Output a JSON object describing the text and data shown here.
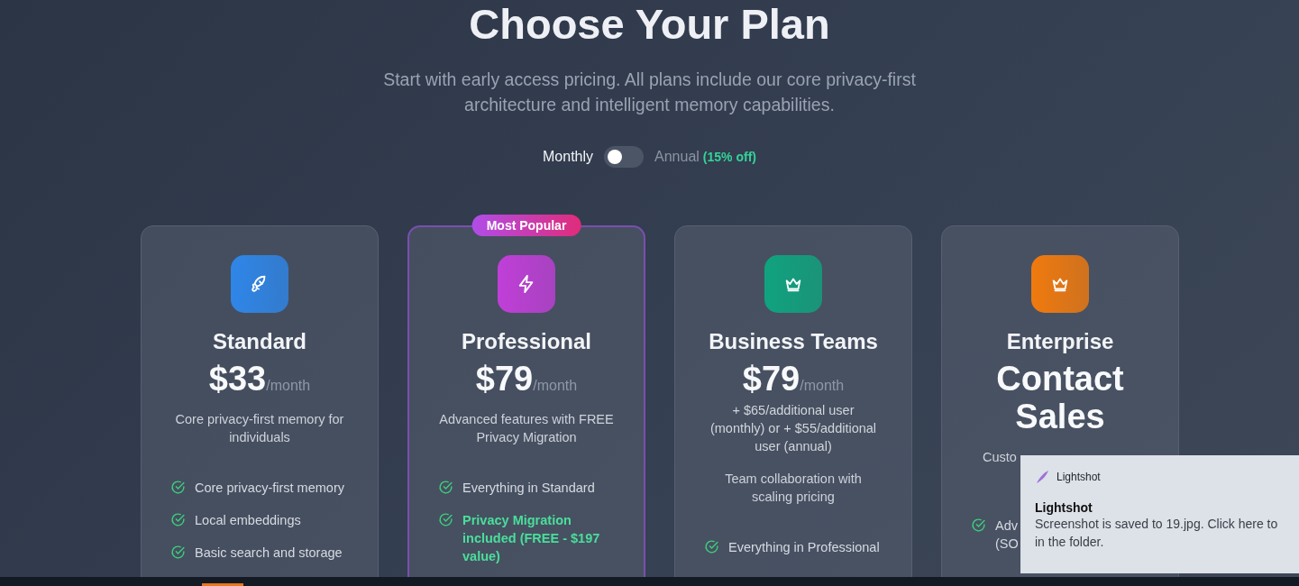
{
  "header": {
    "title": "Choose Your Plan",
    "subtitle": "Start with early access pricing. All plans include our core privacy-first architecture and intelligent memory capabilities."
  },
  "billing": {
    "annual_on": false,
    "options": [
      {
        "label": "Monthly",
        "selected": true
      },
      {
        "label": "Annual",
        "selected": false,
        "discount": "(15% off)"
      }
    ]
  },
  "plans": [
    {
      "name": "Standard",
      "kind": "rocket",
      "color": "#2f86e8",
      "price": "$33",
      "period": "/month",
      "description": "Core privacy-first memory for individuals",
      "featured": false,
      "partly_covered": false,
      "features": [
        {
          "lines": [
            "Core privacy-first memory"
          ],
          "highlight": false
        },
        {
          "lines": [
            "Local embeddings"
          ],
          "highlight": false
        },
        {
          "lines": [
            "Basic search and storage"
          ],
          "highlight": false
        }
      ]
    },
    {
      "name": "Professional",
      "kind": "bolt",
      "color": "#c03fd8",
      "badge": "Most Popular",
      "price": "$79",
      "period": "/month",
      "description": "Advanced features with FREE Privacy Migration",
      "featured": true,
      "partly_covered": false,
      "features": [
        {
          "lines": [
            "Everything in Standard"
          ],
          "highlight": false
        },
        {
          "lines": [
            "Privacy Migration included (FREE - $197 value)"
          ],
          "highlight": true
        }
      ]
    },
    {
      "name": "Business Teams",
      "kind": "crown",
      "color": "#10a37f",
      "price": "$79",
      "period": "/month",
      "note": "+ $65/additional user (monthly) or + $55/additional user (annual)",
      "description": "Team collaboration with scaling pricing",
      "featured": false,
      "partly_covered": false,
      "features": [
        {
          "lines": [
            "Everything in Professional"
          ],
          "highlight": false
        }
      ]
    },
    {
      "name": "Enterprise",
      "kind": "crown",
      "color": "#f07a0e",
      "price": "Contact Sales",
      "description": "Custo",
      "featured": false,
      "partly_covered": true,
      "features": [
        {
          "lines": [
            "Adv",
            "(SO"
          ],
          "highlight": false
        }
      ]
    }
  ],
  "notification": {
    "app": "Lightshot",
    "title": "Lightshot",
    "lines": [
      "Screenshot is saved to 19.jpg. Click here to",
      "in the folder."
    ]
  }
}
